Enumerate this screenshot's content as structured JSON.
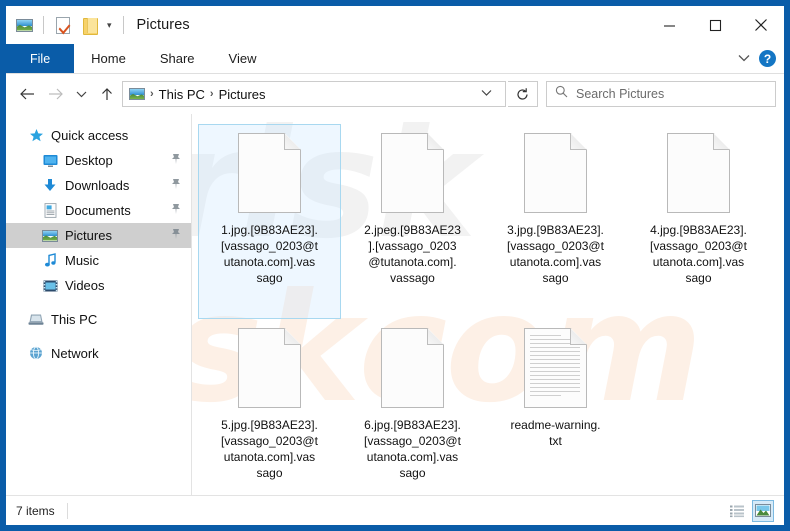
{
  "window": {
    "title": "Pictures",
    "quick_access_icons": [
      "picture-icon",
      "properties-icon",
      "new-folder-icon",
      "customize-caret-icon"
    ],
    "controls": {
      "minimize": "minimize-icon",
      "maximize": "maximize-icon",
      "close": "close-icon"
    }
  },
  "ribbon": {
    "tabs": [
      {
        "label": "File",
        "active": true
      },
      {
        "label": "Home",
        "active": false
      },
      {
        "label": "Share",
        "active": false
      },
      {
        "label": "View",
        "active": false
      }
    ],
    "collapse_icon": "chevron-down-icon",
    "help_label": "?"
  },
  "address_bar": {
    "back_icon": "arrow-left-icon",
    "forward_icon": "arrow-right-icon",
    "recent_icon": "chevron-down-icon",
    "up_icon": "arrow-up-icon",
    "breadcrumbs": [
      "This PC",
      "Pictures"
    ],
    "separator": "›",
    "dropdown_icon": "chevron-down-icon",
    "refresh_icon": "refresh-icon"
  },
  "search": {
    "placeholder": "Search Pictures",
    "icon": "search-icon"
  },
  "sidebar": {
    "items": [
      {
        "label": "Quick access",
        "icon": "star-icon",
        "indent": false,
        "pinned": false,
        "selected": false
      },
      {
        "label": "Desktop",
        "icon": "desktop-icon",
        "indent": true,
        "pinned": true,
        "selected": false
      },
      {
        "label": "Downloads",
        "icon": "download-icon",
        "indent": true,
        "pinned": true,
        "selected": false
      },
      {
        "label": "Documents",
        "icon": "document-icon",
        "indent": true,
        "pinned": true,
        "selected": false
      },
      {
        "label": "Pictures",
        "icon": "picture-icon",
        "indent": true,
        "pinned": true,
        "selected": true
      },
      {
        "label": "Music",
        "icon": "music-note-icon",
        "indent": true,
        "pinned": false,
        "selected": false
      },
      {
        "label": "Videos",
        "icon": "video-icon",
        "indent": true,
        "pinned": false,
        "selected": false
      },
      {
        "label": "This PC",
        "icon": "computer-icon",
        "indent": false,
        "pinned": false,
        "selected": false
      },
      {
        "label": "Network",
        "icon": "network-icon",
        "indent": false,
        "pinned": false,
        "selected": false
      }
    ]
  },
  "files": [
    {
      "name": "1.jpg.[9B83AE23].\n[vassago_0203@t\nutanota.com].vas\nsago",
      "icon": "generic-file-icon",
      "selected": true
    },
    {
      "name": "2.jpeg.[9B83AE23\n].[vassago_0203\n@tutanota.com].\nvassago",
      "icon": "generic-file-icon",
      "selected": false
    },
    {
      "name": "3.jpg.[9B83AE23].\n[vassago_0203@t\nutanota.com].vas\nsago",
      "icon": "generic-file-icon",
      "selected": false
    },
    {
      "name": "4.jpg.[9B83AE23].\n[vassago_0203@t\nutanota.com].vas\nsago",
      "icon": "generic-file-icon",
      "selected": false
    },
    {
      "name": "5.jpg.[9B83AE23].\n[vassago_0203@t\nutanota.com].vas\nsago",
      "icon": "generic-file-icon",
      "selected": false
    },
    {
      "name": "6.jpg.[9B83AE23].\n[vassago_0203@t\nutanota.com].vas\nsago",
      "icon": "generic-file-icon",
      "selected": false
    },
    {
      "name": "readme-warning.\ntxt",
      "icon": "text-file-icon",
      "selected": false
    }
  ],
  "status_bar": {
    "item_count": "7 items",
    "views": [
      {
        "name": "details-view-icon",
        "active": false
      },
      {
        "name": "large-icons-view-icon",
        "active": true
      }
    ]
  },
  "watermark": {
    "top_text": "risk",
    "bottom_text": "riskcom"
  },
  "colors": {
    "window_frame": "#0a5ca8",
    "file_tab": "#0a5ca8",
    "selection": "#cdE8ff",
    "sidebar_selected": "#cfcfcf",
    "accent": "#1476c4"
  }
}
